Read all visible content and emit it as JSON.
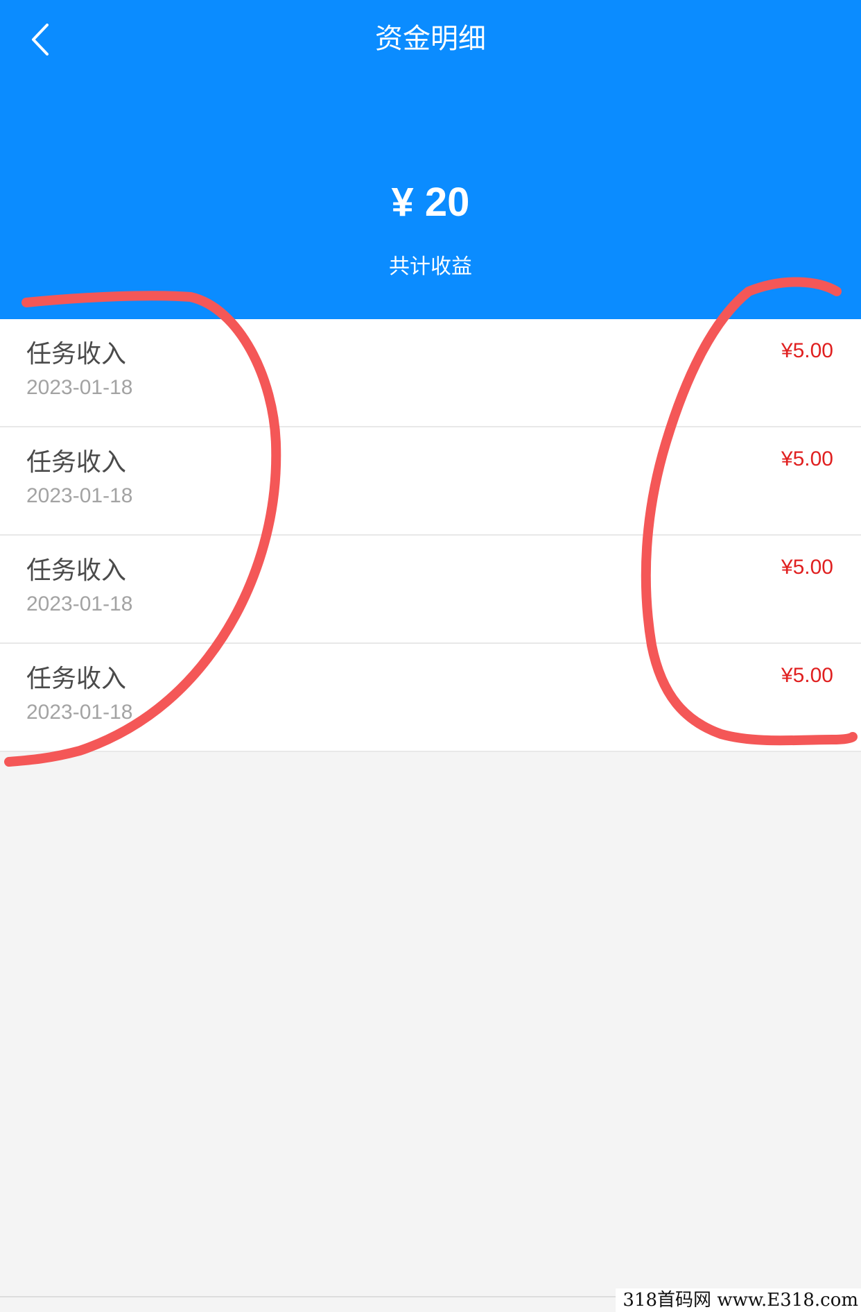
{
  "header": {
    "title": "资金明细",
    "back_icon": "chevron-left-icon",
    "background_color": "#0b8cff"
  },
  "summary": {
    "total_amount": "¥ 20",
    "total_label": "共计收益"
  },
  "transactions": [
    {
      "title": "任务收入",
      "date": "2023-01-18",
      "amount": "¥5.00"
    },
    {
      "title": "任务收入",
      "date": "2023-01-18",
      "amount": "¥5.00"
    },
    {
      "title": "任务收入",
      "date": "2023-01-18",
      "amount": "¥5.00"
    },
    {
      "title": "任务收入",
      "date": "2023-01-18",
      "amount": "¥5.00"
    }
  ],
  "colors": {
    "amount": "#e02020",
    "annotation_stroke": "#f45757"
  },
  "watermark": "318首码网 www.E318.com"
}
